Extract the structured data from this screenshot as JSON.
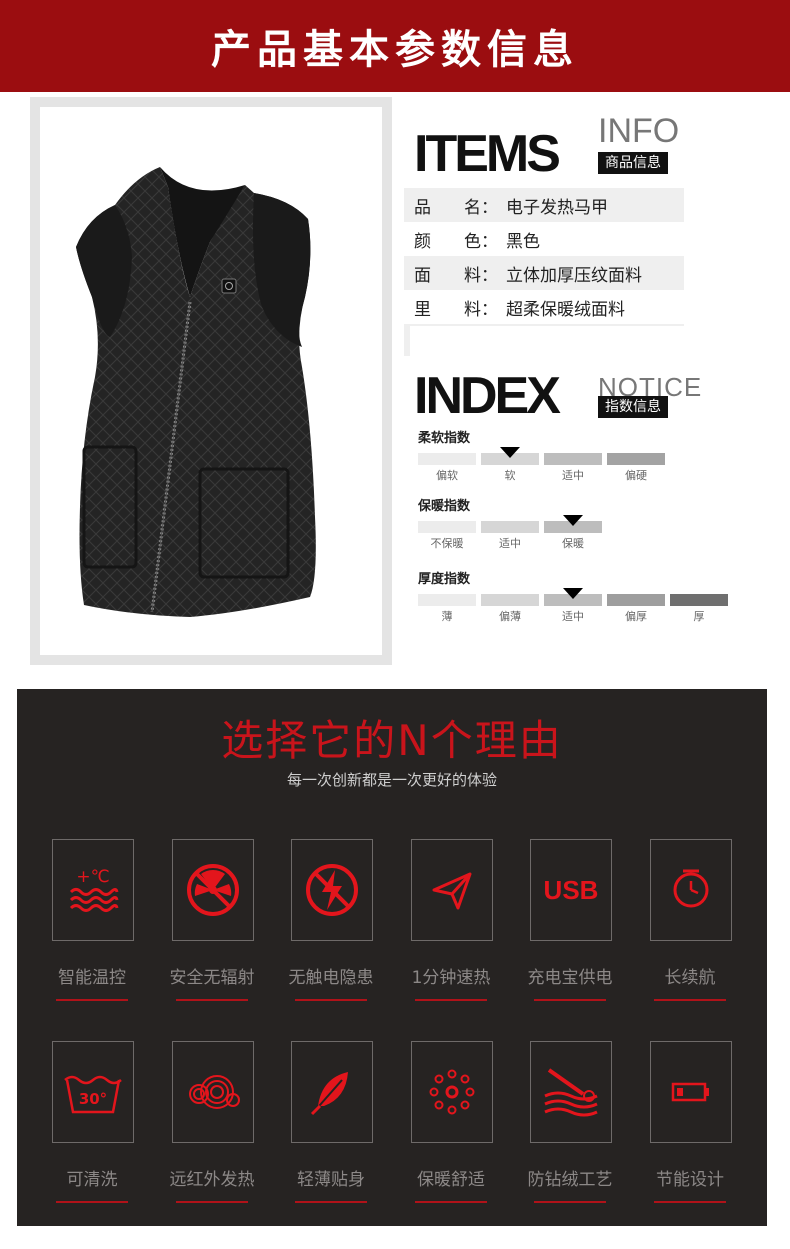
{
  "header": {
    "title": "产品基本参数信息"
  },
  "items_section": {
    "big": "ITEMS",
    "thin": "INFO",
    "tag": "商品信息",
    "rows": [
      {
        "k1": "品",
        "k2": "名",
        "value": "电子发热马甲"
      },
      {
        "k1": "颜",
        "k2": "色",
        "value": "黑色"
      },
      {
        "k1": "面",
        "k2": "料",
        "value": "立体加厚压纹面料"
      },
      {
        "k1": "里",
        "k2": "料",
        "value": "超柔保暖绒面料"
      }
    ]
  },
  "index_section": {
    "big": "INDEX",
    "thin": "NOTICE",
    "tag": "指数信息",
    "scales": [
      {
        "title": "柔软指数",
        "labels": [
          "偏软",
          "软",
          "适中",
          "偏硬"
        ],
        "colors": [
          "#ececec",
          "#d6d6d6",
          "#bdbdbd",
          "#a3a3a3"
        ],
        "selected_index": 1
      },
      {
        "title": "保暖指数",
        "labels": [
          "不保暖",
          "适中",
          "保暖"
        ],
        "colors": [
          "#ececec",
          "#d6d6d6",
          "#bdbdbd"
        ],
        "selected_index": 2
      },
      {
        "title": "厚度指数",
        "labels": [
          "薄",
          "偏薄",
          "适中",
          "偏厚",
          "厚"
        ],
        "colors": [
          "#ececec",
          "#d6d6d6",
          "#bdbdbd",
          "#9e9e9e",
          "#6f6f6f"
        ],
        "selected_index": 2
      }
    ]
  },
  "reasons": {
    "title": "选择它的N个理由",
    "subtitle": "每一次创新都是一次更好的体验",
    "usb_text": "USB",
    "wash_temp": "30°",
    "heat_symbol": "+℃",
    "features": [
      {
        "label": "智能温控",
        "icon": "temperature-wave-icon"
      },
      {
        "label": "安全无辐射",
        "icon": "no-radiation-icon"
      },
      {
        "label": "无触电隐患",
        "icon": "no-shock-icon"
      },
      {
        "label": "1分钟速热",
        "icon": "paper-plane-icon"
      },
      {
        "label": "充电宝供电",
        "icon": "usb-icon"
      },
      {
        "label": "长续航",
        "icon": "clock-icon"
      },
      {
        "label": "可清洗",
        "icon": "wash-30-icon"
      },
      {
        "label": "远红外发热",
        "icon": "infrared-rings-icon"
      },
      {
        "label": "轻薄贴身",
        "icon": "feather-icon"
      },
      {
        "label": "保暖舒适",
        "icon": "dots-circle-icon"
      },
      {
        "label": "防钻绒工艺",
        "icon": "needle-thread-icon"
      },
      {
        "label": "节能设计",
        "icon": "battery-icon"
      }
    ]
  },
  "colors": {
    "brand_red": "#9b0d10",
    "accent_red": "#c9141b",
    "dark_bg": "#262322"
  }
}
